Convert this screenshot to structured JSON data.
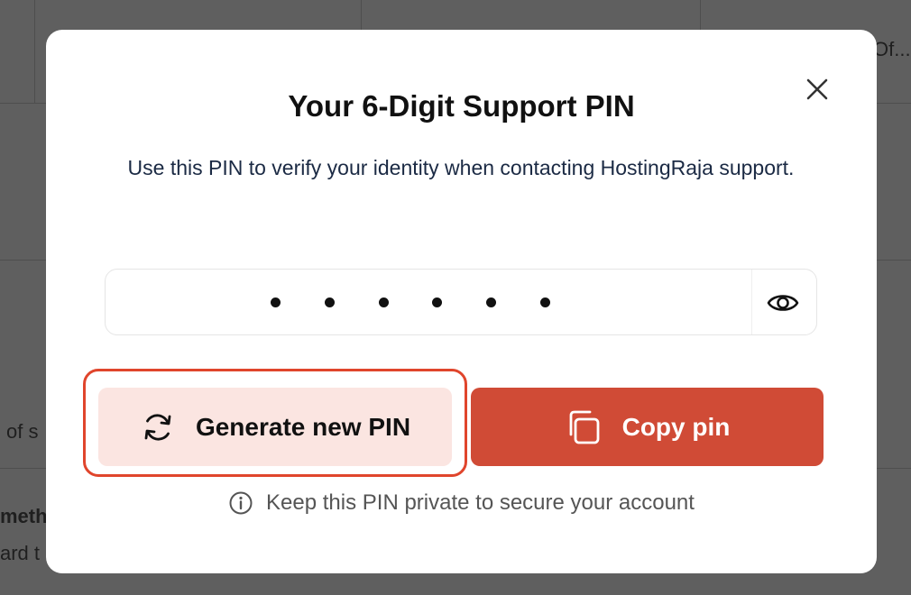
{
  "background": {
    "header_fragment": "Of...",
    "row_fragment": "of s",
    "bold_fragment": "meth",
    "sub_fragment": "ard t"
  },
  "modal": {
    "title": "Your 6-Digit Support PIN",
    "subtitle": "Use this PIN to verify your identity when contacting HostingRaja support.",
    "pin": {
      "masked_length": 6,
      "visibility_icon": "eye-icon"
    },
    "generate_button": {
      "label": "Generate new PIN",
      "icon": "refresh-icon"
    },
    "copy_button": {
      "label": "Copy pin",
      "icon": "copy-icon"
    },
    "note": {
      "text": "Keep this PIN private to secure your account",
      "icon": "info-icon"
    },
    "close_icon": "close-icon"
  },
  "colors": {
    "accent": "#d04b36",
    "accent_light": "#fbe5e1",
    "focus_ring": "#e0452c",
    "overlay": "#5f5f5f"
  }
}
